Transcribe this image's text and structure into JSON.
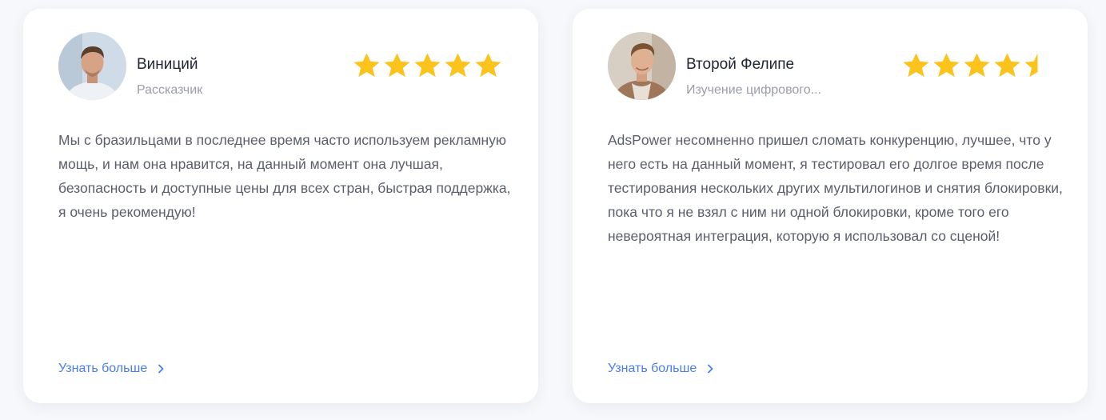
{
  "colors": {
    "star": "#fbc31b",
    "star_empty": "#e4e6ec",
    "link": "#4a7cf2",
    "name": "#222633",
    "role": "#9a9ea9",
    "text": "#5b5f6b",
    "card": "#ffffff",
    "page": "#f7f8fb"
  },
  "reviews": [
    {
      "name": "Виниций",
      "role": "Рассказчик",
      "rating": 5,
      "text": "Мы с бразильцами в последнее время часто используем рекламную мощь, и нам она нравится, на данный момент она лучшая, безопасность и доступные цены для всех стран, быстрая поддержка, я очень рекомендую!",
      "more_label": "Узнать больше",
      "avatar_icon": "person-photo-icon",
      "more_icon": "chevron-right-icon"
    },
    {
      "name": "Второй Фелипе",
      "role": "Изучение цифрового...",
      "rating": 4.5,
      "text": "AdsPower несомненно пришел сломать конкуренцию, лучшее, что у него есть на данный момент, я тестировал его долгое время после тестирования нескольких других мультилогинов и снятия блокировки, пока что я не взял с ним ни одной блокировки, кроме того его невероятная интеграция, которую я использовал со сценой!",
      "more_label": "Узнать больше",
      "avatar_icon": "person-photo-icon",
      "more_icon": "chevron-right-icon"
    }
  ]
}
